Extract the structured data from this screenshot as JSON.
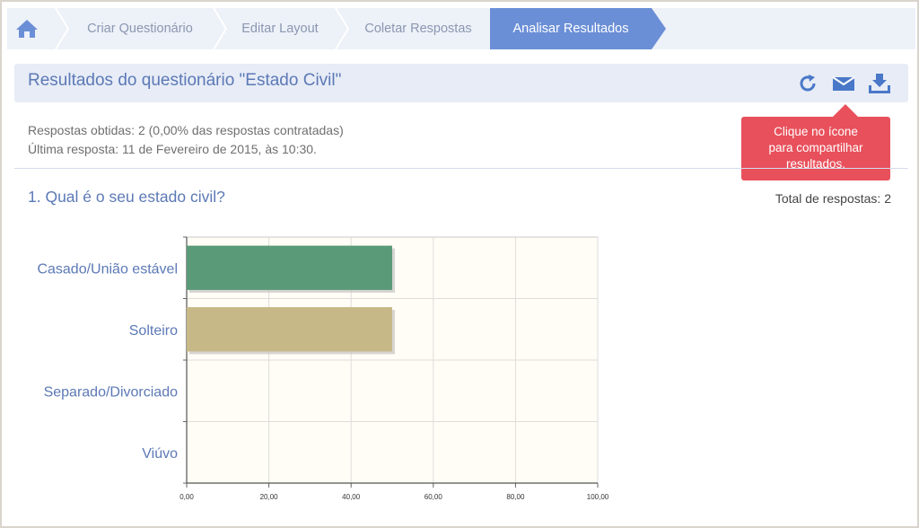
{
  "breadcrumb": {
    "items": [
      {
        "label": "Criar Questionário"
      },
      {
        "label": "Editar Layout"
      },
      {
        "label": "Coletar Respostas"
      },
      {
        "label": "Analisar Resultados",
        "active": true
      }
    ]
  },
  "header": {
    "title": "Resultados do questionário \"Estado Civil\"",
    "icons": [
      "refresh-icon",
      "mail-icon",
      "download-icon"
    ]
  },
  "tooltip": {
    "lines": [
      "Clique no ícone",
      "para compartilhar",
      "resultados."
    ]
  },
  "summary": {
    "responses": "Respostas obtidas: 2 (0,00% das respostas contratadas)",
    "last_response": "Última resposta: 11 de Fevereiro de 2015, às 10:30."
  },
  "question": {
    "title": "1. Qual é o seu estado civil?",
    "total": "Total de respostas: 2"
  },
  "chart_data": {
    "type": "bar",
    "orientation": "horizontal",
    "categories": [
      "Casado/União estável",
      "Solteiro",
      "Separado/Divorciado",
      "Viúvo"
    ],
    "values": [
      50,
      50,
      0,
      0
    ],
    "colors": [
      "#5a9a78",
      "#c7b887",
      "#cccccc",
      "#cccccc"
    ],
    "xlim": [
      0,
      100
    ],
    "xticks": [
      "0,00",
      "20,00",
      "40,00",
      "60,00",
      "80,00",
      "100,00"
    ],
    "grid": true
  },
  "colors": {
    "accent": "#6b8fd6",
    "title_blue": "#5c79b6",
    "tooltip": "#e8505b"
  }
}
